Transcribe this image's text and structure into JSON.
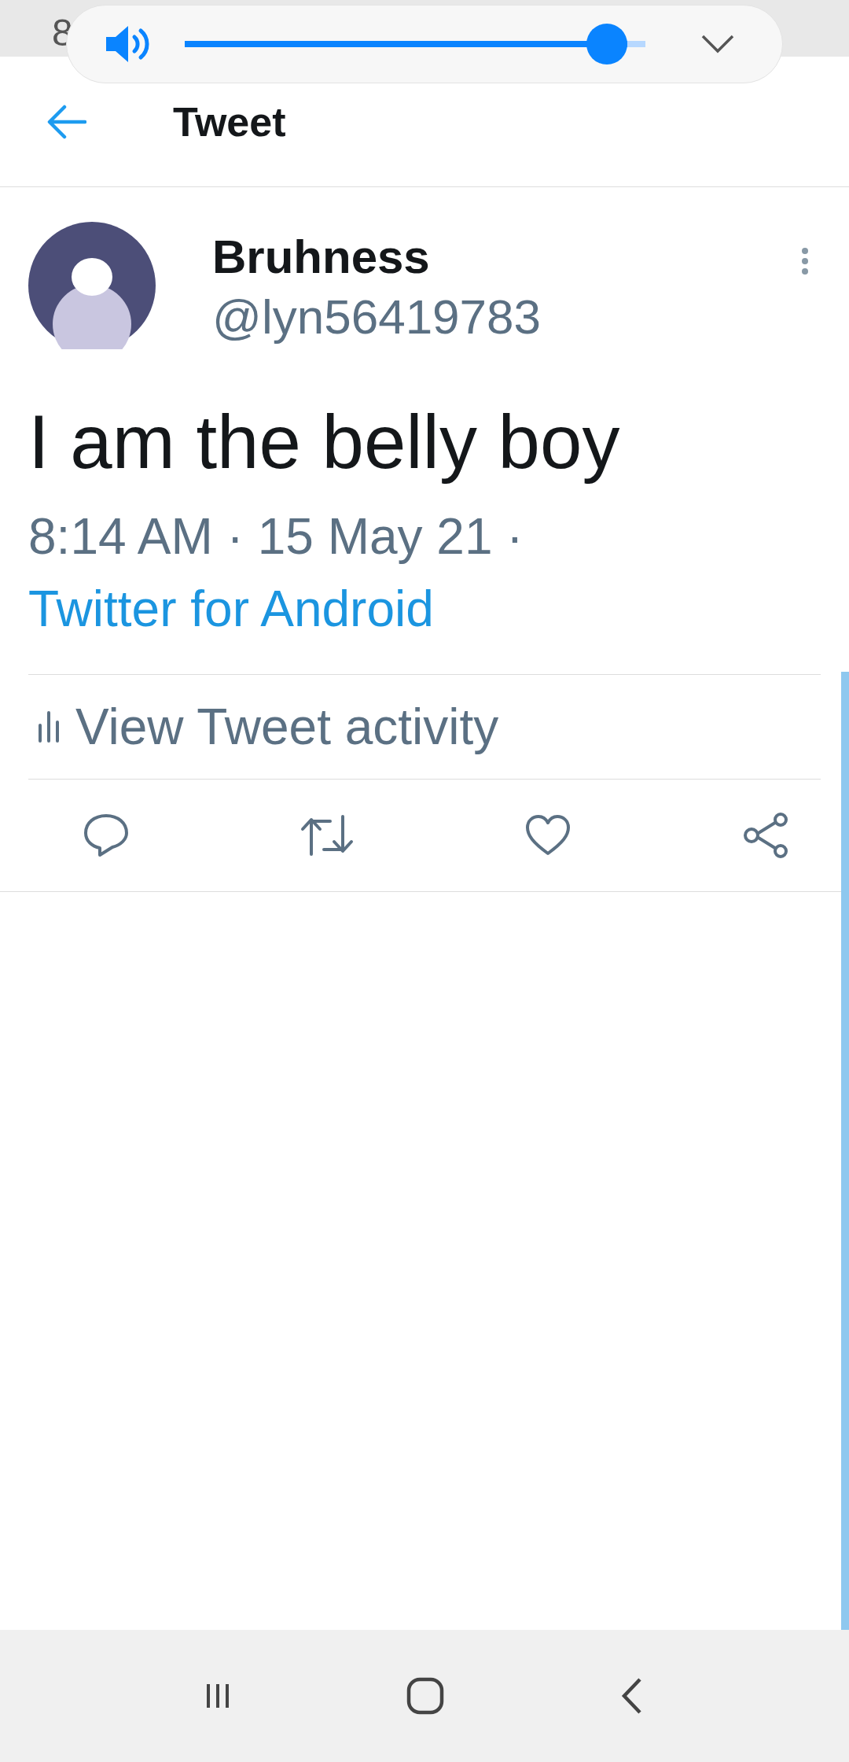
{
  "status_bar": {
    "time": "8"
  },
  "volume_panel": {
    "level": 0.96
  },
  "header": {
    "title": "Tweet"
  },
  "tweet": {
    "name": "Bruhness",
    "handle": "@lyn56419783",
    "text": "I am the belly boy",
    "timestamp": "8:14 AM · 15 May 21 ·",
    "source": "Twitter for Android"
  },
  "activity": {
    "label": "View Tweet activity"
  }
}
